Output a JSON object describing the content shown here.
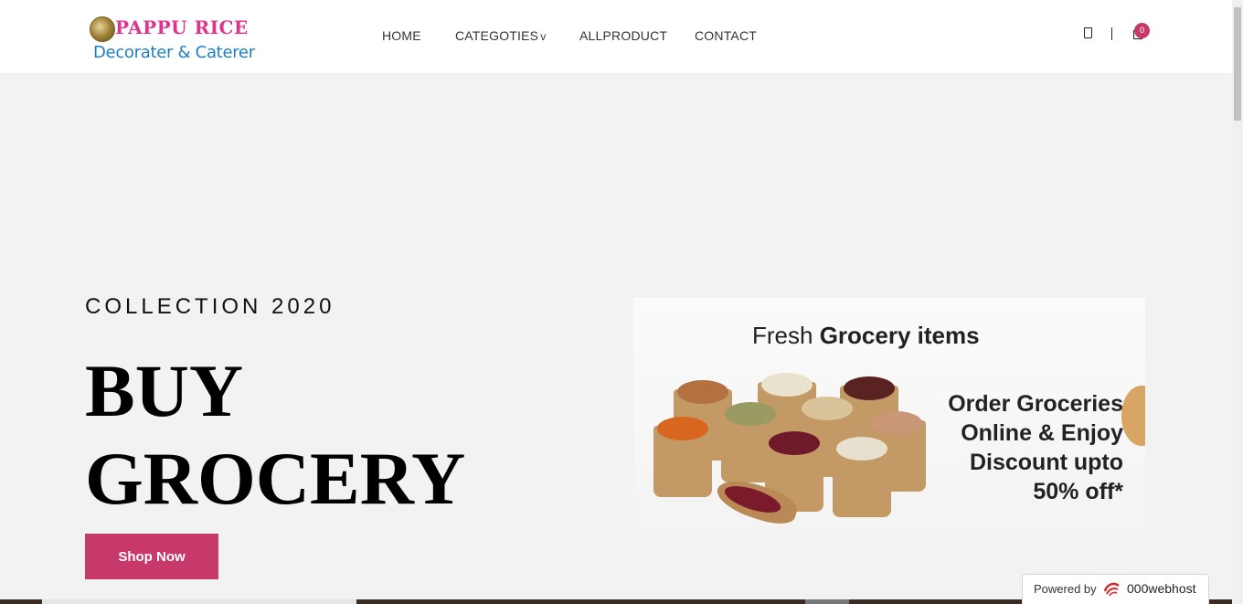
{
  "header": {
    "logo": {
      "title": "PAPPU RICE",
      "subtitle": "Decorater & Caterer"
    },
    "nav": [
      {
        "label": "HOME"
      },
      {
        "label": "CATEGOTIES",
        "chevron": "v"
      },
      {
        "label": "ALLPRODUCT"
      },
      {
        "label": "CONTACT"
      }
    ],
    "cart_count": "0",
    "icons": [
      "search-icon",
      "cart-icon"
    ],
    "accent_color": "#c6396a"
  },
  "hero": {
    "subtitle": "COLLECTION 2020",
    "title_line1": "BUY",
    "title_line2": "GROCERY",
    "button_label": "Shop Now"
  },
  "banner": {
    "headline_light": "Fresh ",
    "headline_bold": "Grocery items",
    "offer_lines": [
      "Order Groceries",
      "Online & Enjoy",
      "Discount upto",
      "50% off*"
    ]
  },
  "footer_badge": {
    "label": "Powered by",
    "brand": "000webhost"
  }
}
